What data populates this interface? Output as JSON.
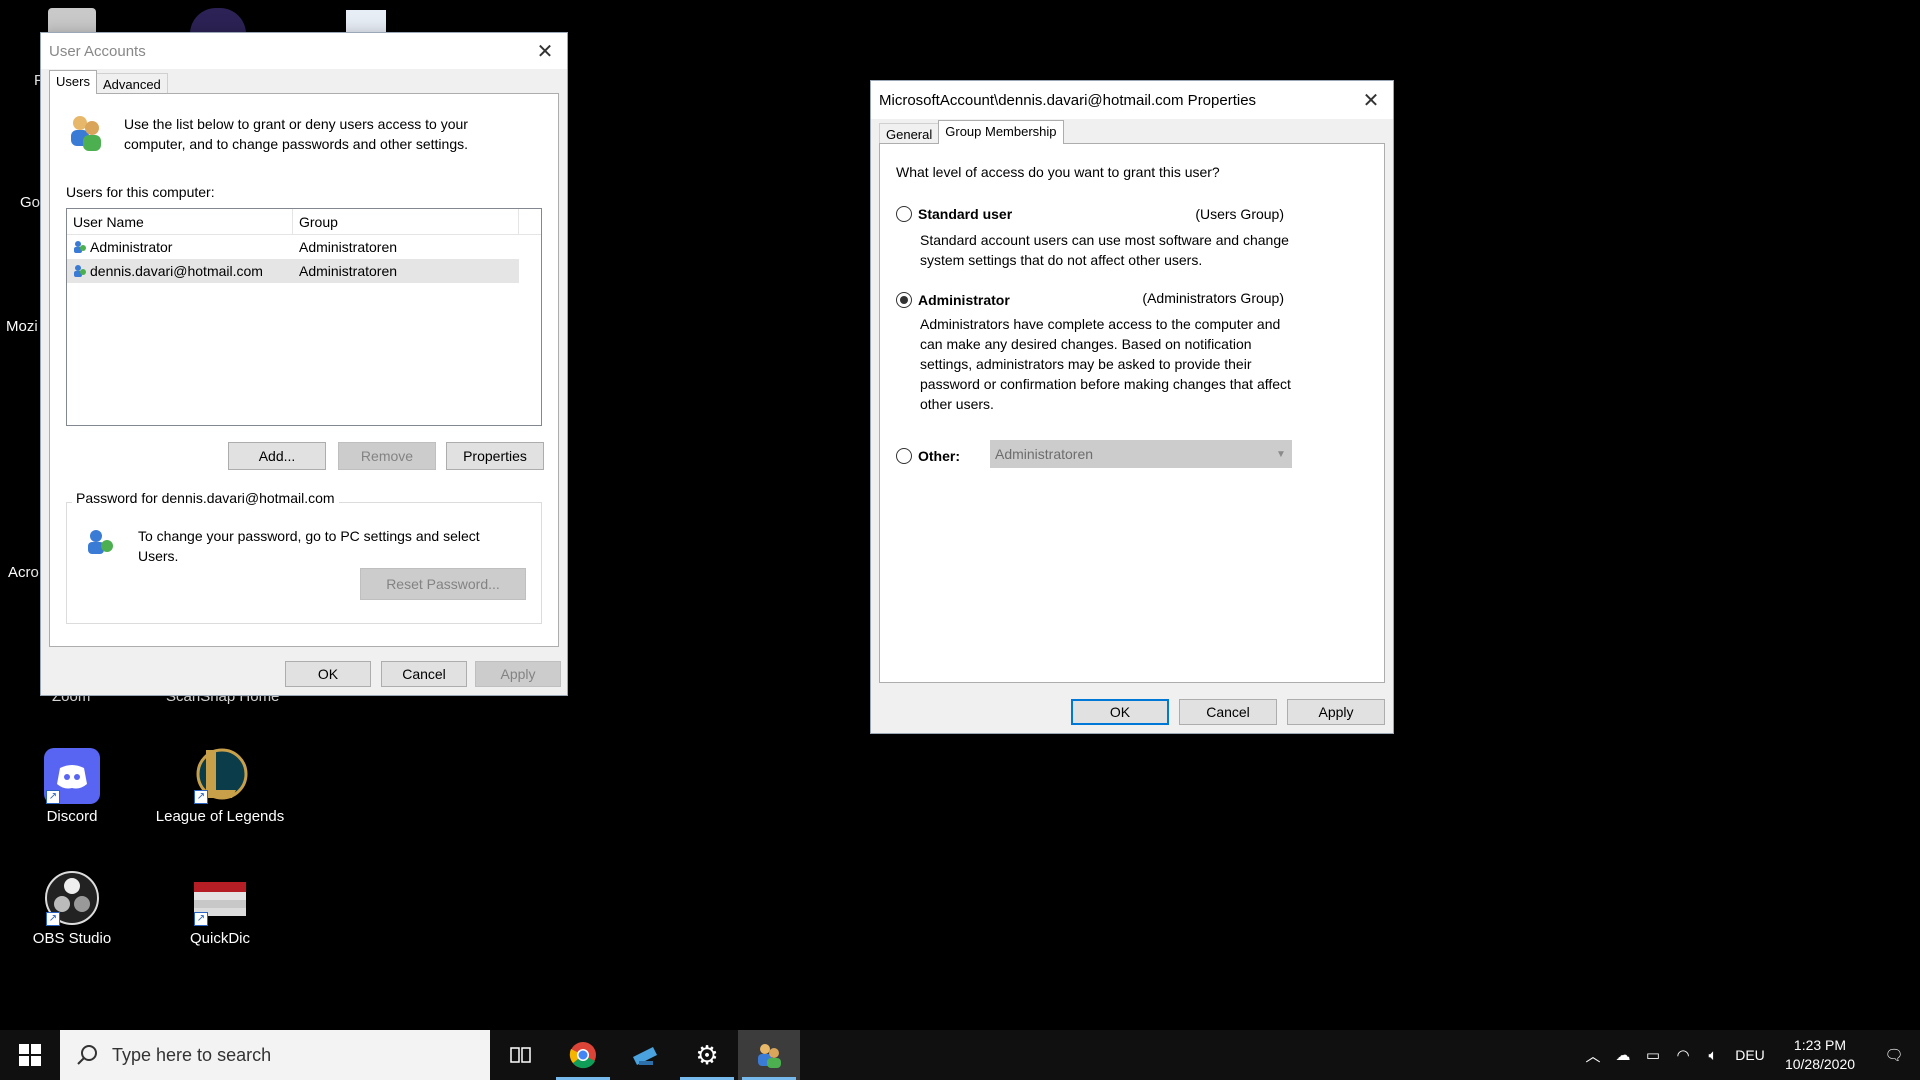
{
  "desktop": {
    "icons": [
      {
        "label": "Discord"
      },
      {
        "label": "League of Legends"
      },
      {
        "label": "OBS Studio"
      },
      {
        "label": "QuickDic"
      }
    ],
    "fragments": [
      "F",
      "Go",
      "Mozi",
      "Acro",
      "Zoom",
      "ScanSnap Home"
    ]
  },
  "user_accounts": {
    "title": "User Accounts",
    "tabs": [
      {
        "label": "Users"
      },
      {
        "label": "Advanced"
      }
    ],
    "intro": "Use the list below to grant or deny users access to your computer, and to change passwords and other settings.",
    "users_label": "Users for this computer:",
    "columns": [
      "User Name",
      "Group"
    ],
    "rows": [
      {
        "name": "Administrator",
        "group": "Administratoren"
      },
      {
        "name": "dennis.davari@hotmail.com",
        "group": "Administratoren"
      }
    ],
    "buttons": {
      "add": "Add...",
      "remove": "Remove",
      "properties": "Properties"
    },
    "password_group": "Password for dennis.davari@hotmail.com",
    "password_text": "To change your password, go to PC settings and select Users.",
    "reset_password": "Reset Password...",
    "ok": "OK",
    "cancel": "Cancel",
    "apply": "Apply"
  },
  "properties": {
    "title": "MicrosoftAccount\\dennis.davari@hotmail.com Properties",
    "tabs": [
      {
        "label": "General"
      },
      {
        "label": "Group Membership"
      }
    ],
    "question": "What level of access do you want to grant this user?",
    "standard": {
      "label": "Standard user",
      "group": "(Users Group)",
      "desc": "Standard account users can use most software and change system settings that do not affect other users."
    },
    "administrator": {
      "label": "Administrator",
      "group": "(Administrators Group)",
      "desc": "Administrators have complete access to the computer and can make any desired changes. Based on notification settings, administrators may be asked to provide their password or confirmation before making changes that affect other users."
    },
    "other": {
      "label": "Other:",
      "value": "Administratoren"
    },
    "ok": "OK",
    "cancel": "Cancel",
    "apply": "Apply"
  },
  "taskbar": {
    "search_placeholder": "Type here to search",
    "language": "DEU",
    "time": "1:23 PM",
    "date": "10/28/2020"
  },
  "colors": {
    "accent": "#0078d7",
    "desktop": "#000000",
    "taskbar": "#101010"
  }
}
